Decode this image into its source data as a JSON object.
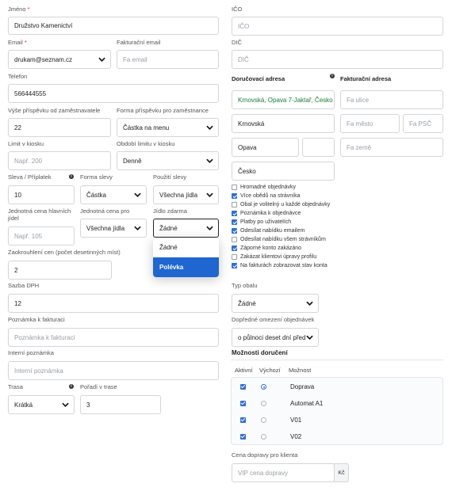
{
  "left": {
    "jmeno": {
      "label": "Jméno",
      "required_mark": "*",
      "value": "Družstvo Kamenictví"
    },
    "email": {
      "label": "Email",
      "required_mark": "*",
      "value": "drukam@seznam.cz"
    },
    "fakturacni_email": {
      "label": "Fakturační email",
      "placeholder": "Fa email"
    },
    "telefon": {
      "label": "Telefon",
      "value": "566444555"
    },
    "vyse_prispevku": {
      "label": "Výše příspěvku od zaměstnavatele",
      "value": "22"
    },
    "forma_prispevku": {
      "label": "Forma příspěvku pro zaměstnance",
      "value": "Částka na menu"
    },
    "limit": {
      "label": "Limit v kiosku",
      "placeholder": "Např. 200"
    },
    "obdobi_limitu": {
      "label": "Období limitu v kiosku",
      "value": "Denně"
    },
    "sleva": {
      "label": "Sleva / Příplatek",
      "value": "10"
    },
    "forma_slevy": {
      "label": "Forma slevy",
      "value": "Částka"
    },
    "pouziti_slevy": {
      "label": "Použití slevy",
      "value": "Všechna jídla"
    },
    "jednotna_cena_hl": {
      "label_1": "Jednotná cena hlavních",
      "label_2": "jídel",
      "placeholder": "Např. 105"
    },
    "jednotna_cena_pro": {
      "label": "Jednotná cena pro",
      "value": "Všechna jídla"
    },
    "jidlo_zdarma": {
      "label": "Jídlo zdarma",
      "value": "Žádné",
      "options": [
        "Žádné",
        "Polévka"
      ],
      "highlighted": "Polévka"
    },
    "zaokrouhleni": {
      "label": "Zaokrouhlení cen (počet desetinných míst)",
      "value": "2"
    },
    "sazba_dph": {
      "label": "Sazba DPH",
      "value": "12"
    },
    "poznamka_fakturaci": {
      "label": "Poznámka k fakturaci",
      "placeholder": "Poznámka k fakturaci"
    },
    "interni_poznamka": {
      "label": "Interní poznámka",
      "placeholder": "Interní poznámka"
    },
    "trasa": {
      "label": "Trasa",
      "value": "Krátká"
    },
    "poradi_trasa": {
      "label": "Pořadí v trase",
      "value": "3"
    }
  },
  "right": {
    "ico": {
      "label": "IČO",
      "placeholder": "IČO"
    },
    "dic": {
      "label": "DIČ",
      "placeholder": "DIČ"
    },
    "dorucovaci_adresa": {
      "label": "Doručovací adresa",
      "street": "Krnovská, Opava 7-Jaktař, Česko",
      "city": "Krnovská",
      "town": "Opava",
      "zip": "",
      "country": "Česko"
    },
    "fakturacni_adresa": {
      "label": "Fakturační adresa",
      "street_placeholder": "Fa ulice",
      "city_placeholder": "Fa město",
      "zip_placeholder": "Fa PSČ",
      "country_placeholder": "Fa země"
    },
    "checkboxes": [
      {
        "label": "Hromadné objednávky",
        "checked": false
      },
      {
        "label": "Více obědů na strávníka",
        "checked": true
      },
      {
        "label": "Obal je volitelný u každé objednávky",
        "checked": false
      },
      {
        "label": "Poznámka k objednávce",
        "checked": true
      },
      {
        "label": "Platby po uživatelích",
        "checked": true
      },
      {
        "label": "Odesílat nabídku emailem",
        "checked": true
      },
      {
        "label": "Odesílat nabídku všem strávníkům",
        "checked": false
      },
      {
        "label": "Záporné konto zakázáno",
        "checked": true
      },
      {
        "label": "Zakázat klientovi úpravy profilu",
        "checked": false
      },
      {
        "label": "Na fakturách zobrazovat stav konta",
        "checked": true
      }
    ],
    "typ_obalu": {
      "label": "Typ obalu",
      "value": "Žádné"
    },
    "dopredne_omezeni": {
      "label": "Dopředné omezení objednávek",
      "value": "o půlnoci deset dní před"
    },
    "moznosti_doruceni": {
      "title": "Možnosti doručení",
      "headers": {
        "aktivni": "Aktivní",
        "vychozi": "Výchozí",
        "moznost": "Možnost"
      },
      "rows": [
        {
          "name": "Doprava",
          "active": true,
          "default": true
        },
        {
          "name": "Automat A1",
          "active": true,
          "default": false
        },
        {
          "name": "V01",
          "active": true,
          "default": false
        },
        {
          "name": "V02",
          "active": true,
          "default": false
        }
      ]
    },
    "cena_dopravy": {
      "label": "Cena dopravy pro klienta",
      "placeholder": "VIP cena dopravy",
      "unit": "Kč"
    }
  }
}
